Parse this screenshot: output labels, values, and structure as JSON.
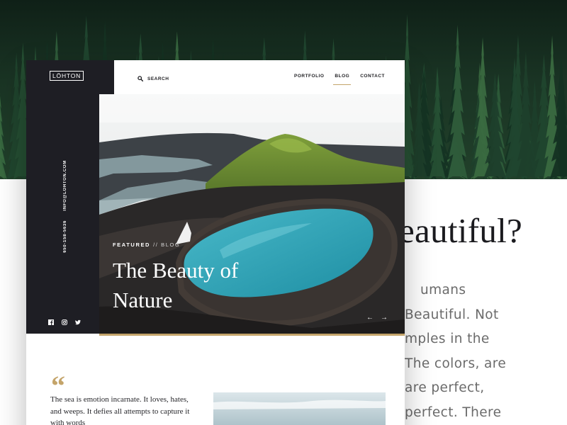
{
  "header": {
    "logo": "LÖHTON",
    "search_label": "SEARCH",
    "nav": [
      {
        "label": "PORTFOLIO",
        "active": false
      },
      {
        "label": "BLOG",
        "active": true
      },
      {
        "label": "CONTACT",
        "active": false
      }
    ]
  },
  "sidebar": {
    "email": "INFO@LOHTON.COM",
    "phone": "650-158-5636",
    "social": [
      "facebook-icon",
      "instagram-icon",
      "twitter-icon"
    ]
  },
  "hero": {
    "kicker_label": "FEATURED",
    "kicker_category": "// BLOG",
    "title": "The Beauty of Nature",
    "prev_arrow": "←",
    "next_arrow": "→"
  },
  "article": {
    "quote_mark": "“",
    "body": "The sea is emotion incarnate. It loves, hates, and weeps. It defies all attempts to capture it with words"
  },
  "background_article": {
    "heading": "eautiful?",
    "lines": [
      "umans",
      "Beautiful. Not",
      "mples in the",
      "The colors, are",
      "are perfect,",
      "perfect. There"
    ]
  },
  "colors": {
    "accent": "#c4a46a",
    "sidebar": "#1e1e24",
    "lake": "#33a6b8"
  }
}
